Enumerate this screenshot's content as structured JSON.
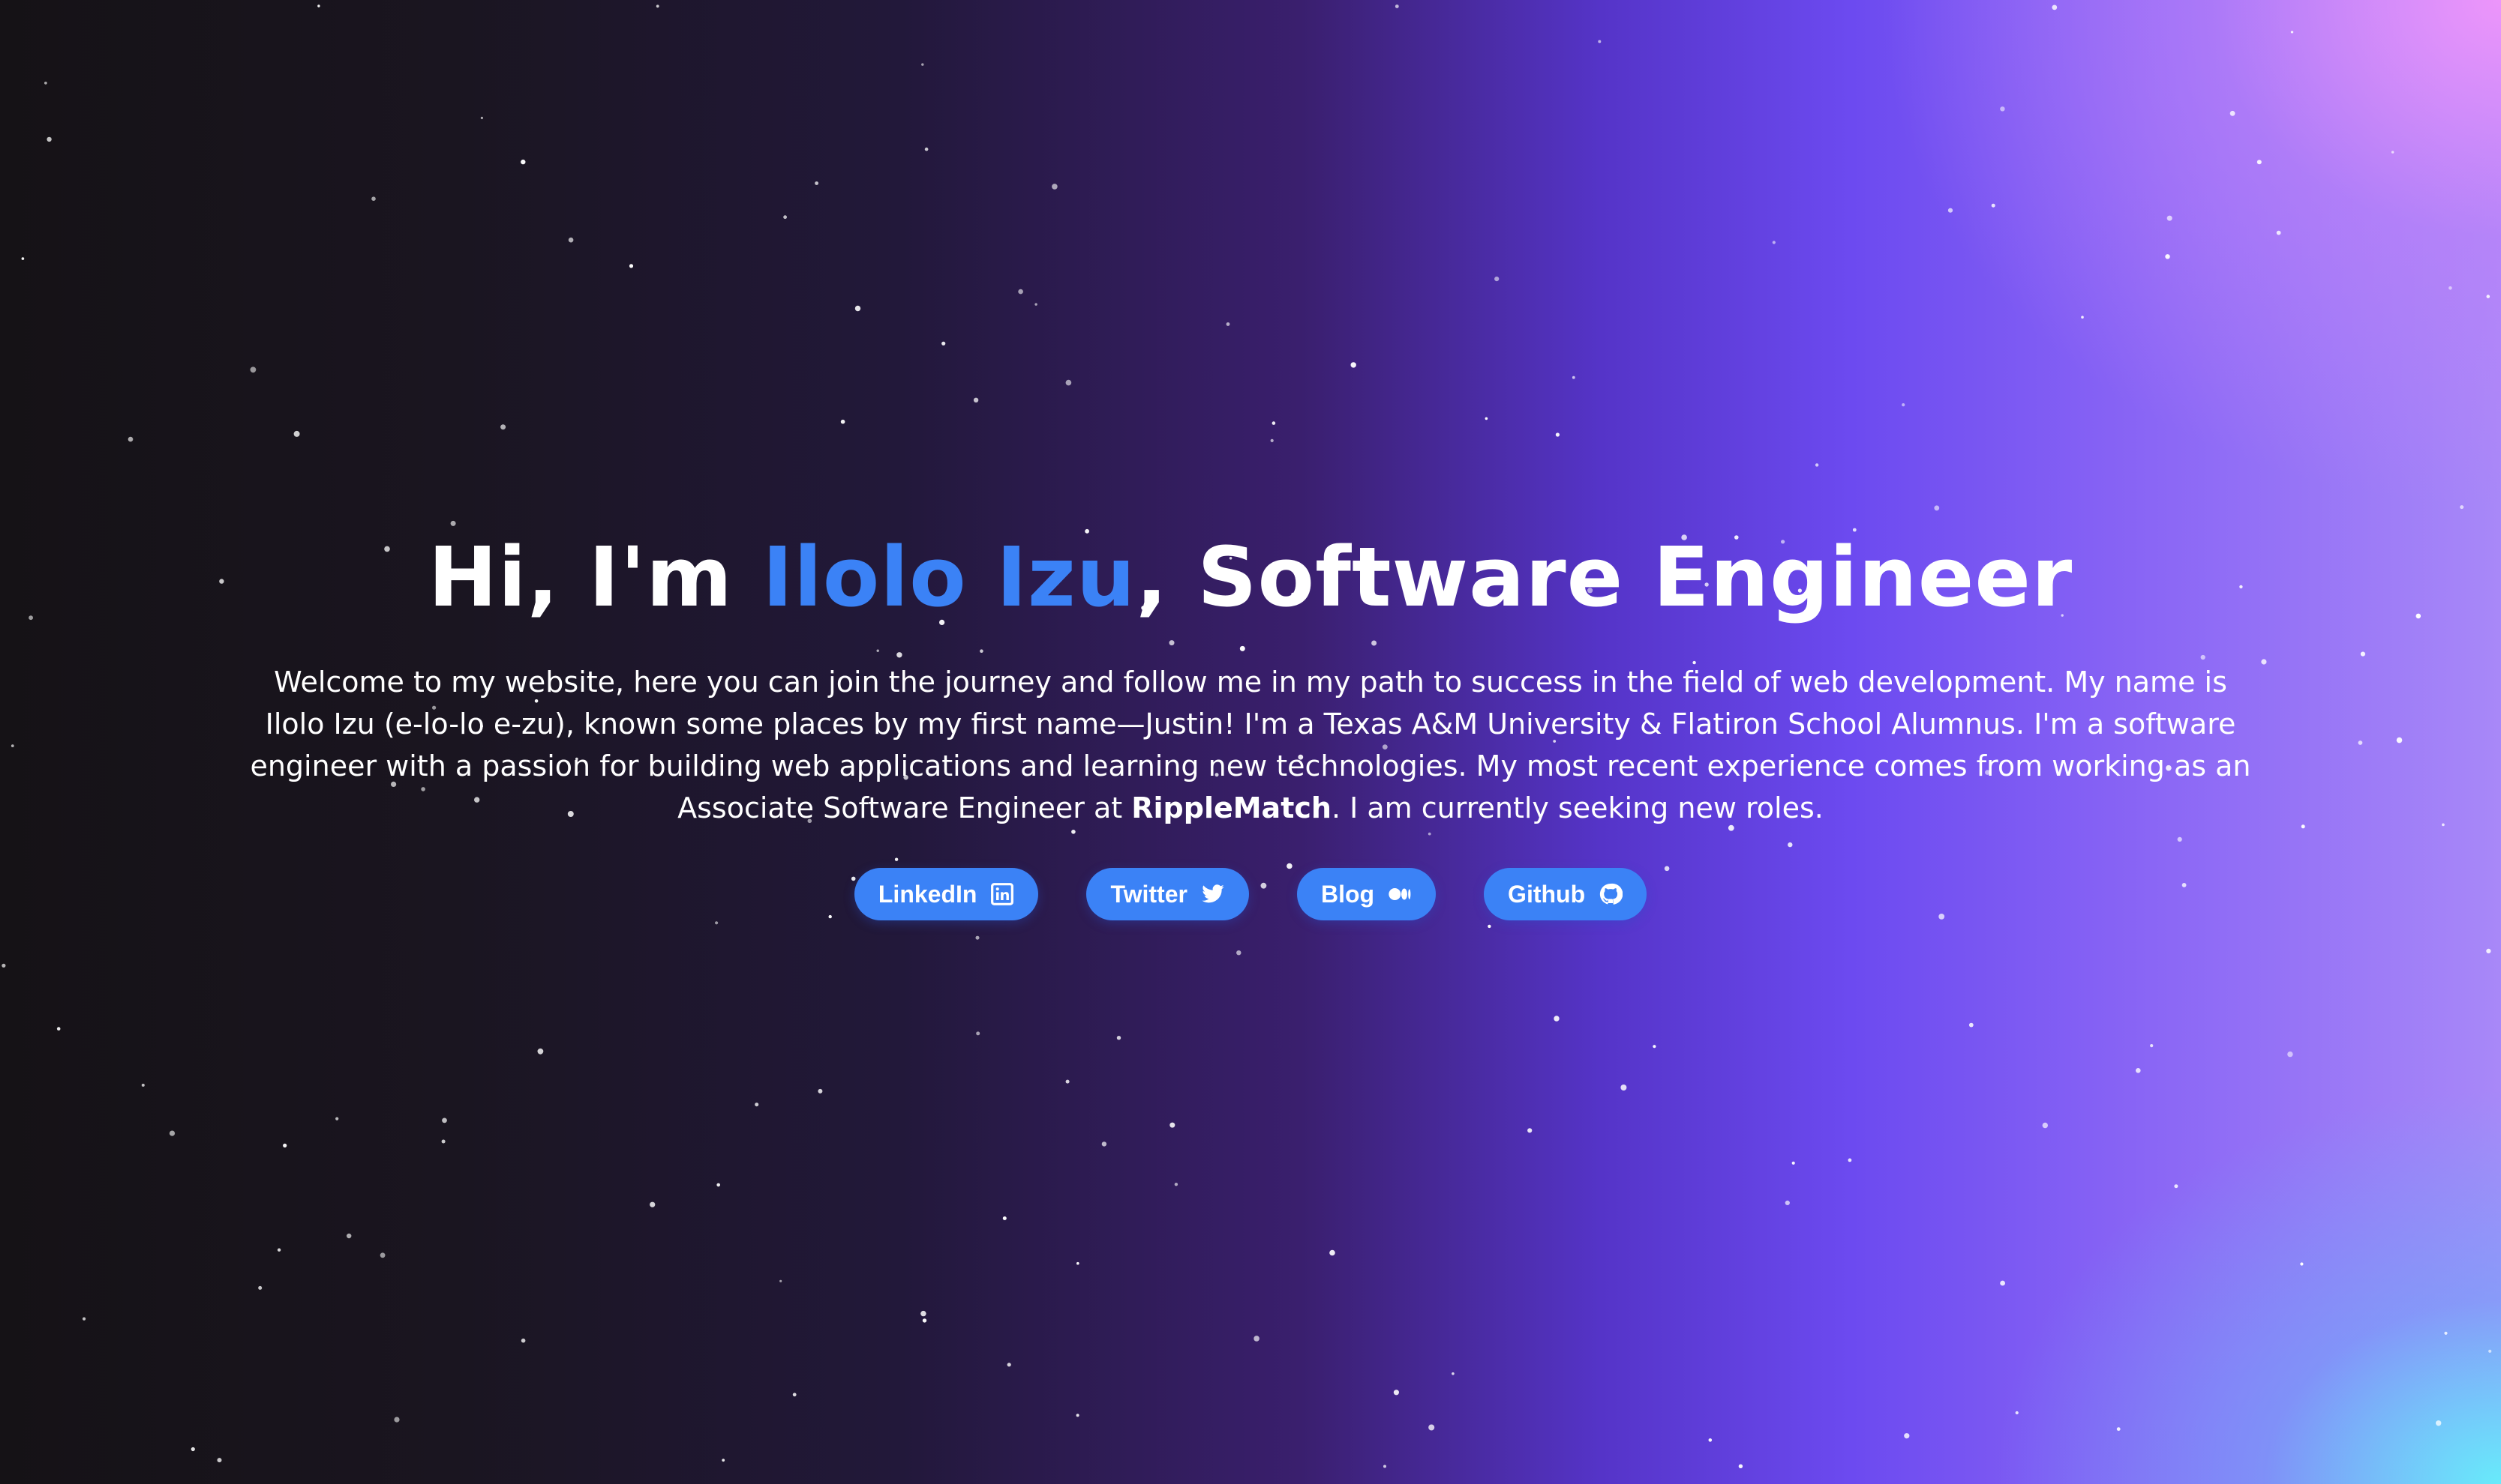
{
  "hero": {
    "title_prefix": "Hi, I'm ",
    "title_name": "Ilolo Izu",
    "title_suffix": ", Software Engineer",
    "intro_text": "Welcome to my website, here you can join the journey and follow me in my path to success in the field of web development. My name is Ilolo Izu (e-lo-lo e-zu), known some places by my first name—Justin! I'm a Texas A&M University & Flatiron School Alumnus. I'm a software engineer with a passion for building web applications and learning new technologies. My most recent experience comes from working as an Associate Software Engineer at ",
    "intro_company": "RippleMatch",
    "intro_end": ". I am currently seeking new roles."
  },
  "links": [
    {
      "label": "LinkedIn",
      "icon": "linkedin-icon"
    },
    {
      "label": "Twitter",
      "icon": "twitter-icon"
    },
    {
      "label": "Blog",
      "icon": "medium-icon"
    },
    {
      "label": "Github",
      "icon": "github-icon"
    }
  ],
  "colors": {
    "accent": "#3b82f6",
    "text": "#ffffff",
    "background_dark": "#151216",
    "background_purple": "#6c4af0",
    "corner_pink": "#f096fa",
    "corner_cyan": "#64f0fa"
  }
}
